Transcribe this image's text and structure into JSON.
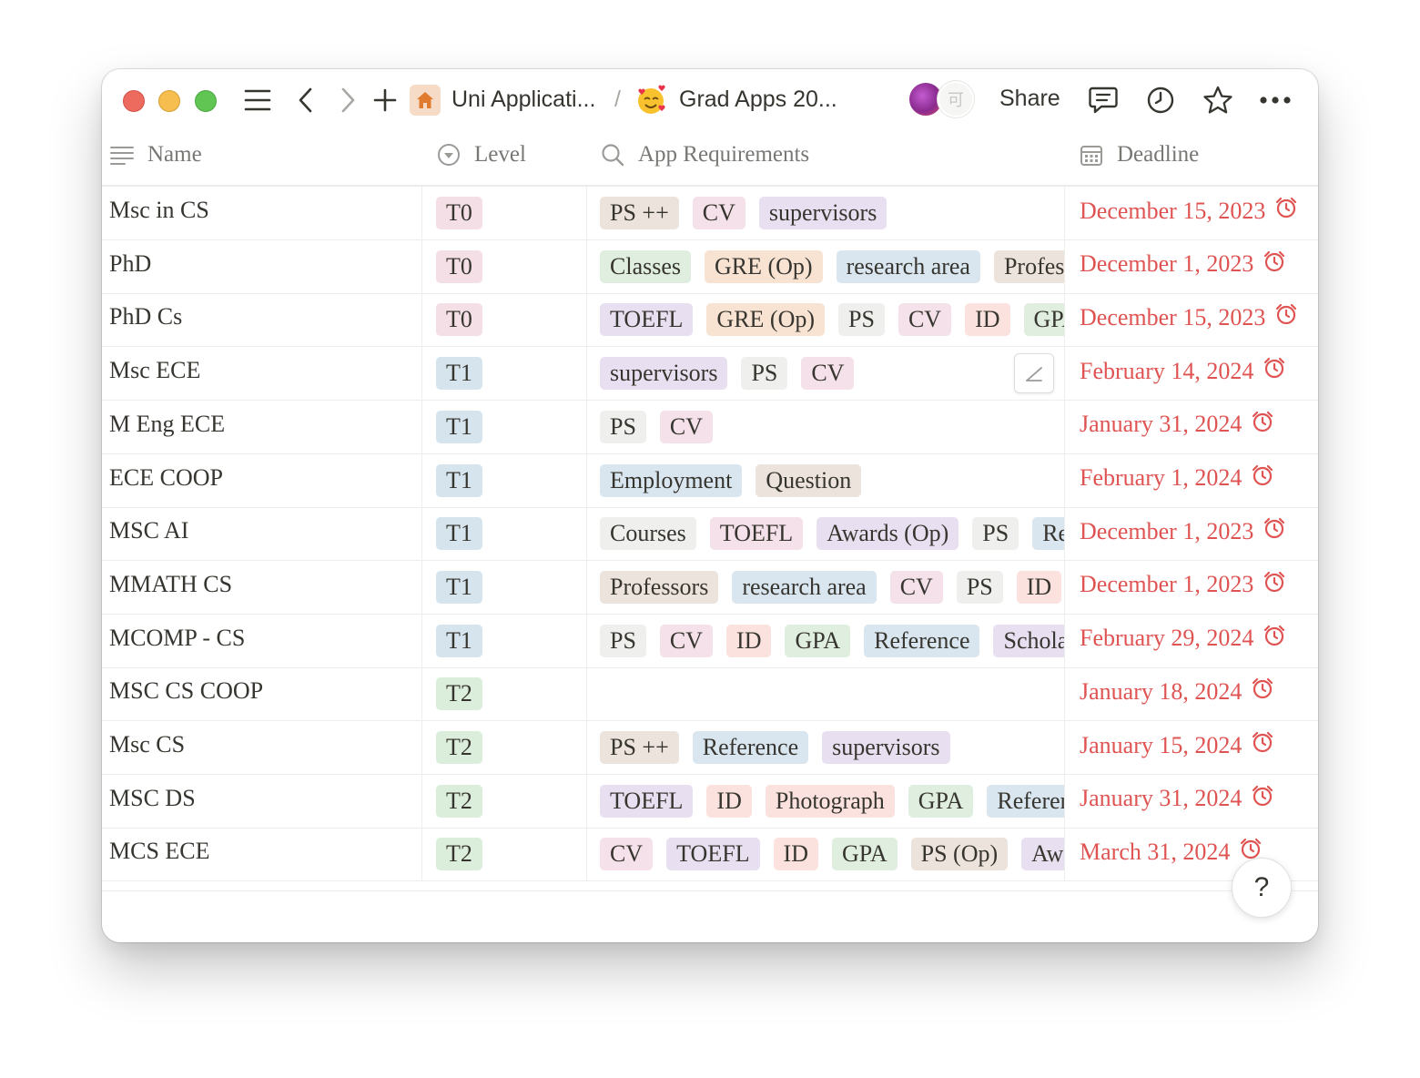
{
  "titlebar": {
    "breadcrumb": [
      {
        "icon": "house-icon",
        "label": "Uni Applicati..."
      },
      {
        "icon": "smiling-face-with-hearts-emoji",
        "label": "Grad Apps 20..."
      }
    ],
    "separator": "/",
    "avatar2_text": "可",
    "share_label": "Share"
  },
  "columns": {
    "name": "Name",
    "level": "Level",
    "requirements": "App Requirements",
    "deadline": "Deadline"
  },
  "colors": {
    "date_red": "#df5452",
    "level_T0": "#f4dfe6",
    "level_T1": "#d6e4ee",
    "level_T2": "#dbeddb"
  },
  "rows": [
    {
      "name": "Msc in CS",
      "level": "T0",
      "deadline": "December 15, 2023",
      "tags": [
        {
          "label": "PS ++",
          "color": "brown"
        },
        {
          "label": "CV",
          "color": "pink"
        },
        {
          "label": "supervisors",
          "color": "purple"
        }
      ]
    },
    {
      "name": "PhD",
      "level": "T0",
      "deadline": "December 1, 2023",
      "tags": [
        {
          "label": "Classes",
          "color": "green"
        },
        {
          "label": "GRE (Op)",
          "color": "orange"
        },
        {
          "label": "research area",
          "color": "blue"
        },
        {
          "label": "Professors",
          "color": "brown"
        }
      ]
    },
    {
      "name": "PhD Cs",
      "level": "T0",
      "deadline": "December 15, 2023",
      "tags": [
        {
          "label": "TOEFL",
          "color": "purple"
        },
        {
          "label": "GRE (Op)",
          "color": "orange"
        },
        {
          "label": "PS",
          "color": "gray"
        },
        {
          "label": "CV",
          "color": "pink"
        },
        {
          "label": "ID",
          "color": "red"
        },
        {
          "label": "GPA",
          "color": "green"
        }
      ]
    },
    {
      "name": "Msc ECE",
      "level": "T1",
      "deadline": "February 14, 2024",
      "tags": [
        {
          "label": "supervisors",
          "color": "purple"
        },
        {
          "label": "PS",
          "color": "gray"
        },
        {
          "label": "CV",
          "color": "pink"
        }
      ]
    },
    {
      "name": "M Eng ECE",
      "level": "T1",
      "deadline": "January 31, 2024",
      "tags": [
        {
          "label": "PS",
          "color": "gray"
        },
        {
          "label": "CV",
          "color": "pink"
        }
      ]
    },
    {
      "name": "ECE COOP",
      "level": "T1",
      "deadline": "February 1, 2024",
      "tags": [
        {
          "label": "Employment",
          "color": "blue"
        },
        {
          "label": "Question",
          "color": "brown"
        }
      ]
    },
    {
      "name": "MSC AI",
      "level": "T1",
      "deadline": "December 1, 2023",
      "tags": [
        {
          "label": "Courses",
          "color": "gray"
        },
        {
          "label": "TOEFL",
          "color": "pink"
        },
        {
          "label": "Awards (Op)",
          "color": "purple"
        },
        {
          "label": "PS",
          "color": "gray"
        },
        {
          "label": "Re",
          "color": "blue"
        }
      ]
    },
    {
      "name": "MMATH CS",
      "level": "T1",
      "deadline": "December 1, 2023",
      "tags": [
        {
          "label": "Professors",
          "color": "brown"
        },
        {
          "label": "research area",
          "color": "blue"
        },
        {
          "label": "CV",
          "color": "pink"
        },
        {
          "label": "PS",
          "color": "gray"
        },
        {
          "label": "ID",
          "color": "red"
        }
      ]
    },
    {
      "name": "MCOMP - CS",
      "level": "T1",
      "deadline": "February 29, 2024",
      "tags": [
        {
          "label": "PS",
          "color": "gray"
        },
        {
          "label": "CV",
          "color": "pink"
        },
        {
          "label": "ID",
          "color": "red"
        },
        {
          "label": "GPA",
          "color": "green"
        },
        {
          "label": "Reference",
          "color": "blue"
        },
        {
          "label": "Scholarship",
          "color": "purple"
        }
      ]
    },
    {
      "name": "MSC CS COOP",
      "level": "T2",
      "deadline": "January 18, 2024",
      "tags": []
    },
    {
      "name": "Msc CS",
      "level": "T2",
      "deadline": "January 15, 2024",
      "tags": [
        {
          "label": "PS ++",
          "color": "brown"
        },
        {
          "label": "Reference",
          "color": "blue"
        },
        {
          "label": "supervisors",
          "color": "purple"
        }
      ]
    },
    {
      "name": "MSC DS",
      "level": "T2",
      "deadline": "January 31, 2024",
      "tags": [
        {
          "label": "TOEFL",
          "color": "purple"
        },
        {
          "label": "ID",
          "color": "red"
        },
        {
          "label": "Photograph",
          "color": "red"
        },
        {
          "label": "GPA",
          "color": "green"
        },
        {
          "label": "Reference",
          "color": "blue"
        }
      ]
    },
    {
      "name": "MCS ECE",
      "level": "T2",
      "deadline": "March 31, 2024",
      "tags": [
        {
          "label": "CV",
          "color": "pink"
        },
        {
          "label": "TOEFL",
          "color": "purple"
        },
        {
          "label": "ID",
          "color": "red"
        },
        {
          "label": "GPA",
          "color": "green"
        },
        {
          "label": "PS (Op)",
          "color": "brown"
        },
        {
          "label": "Awards",
          "color": "purple"
        }
      ]
    }
  ],
  "help_label": "?"
}
